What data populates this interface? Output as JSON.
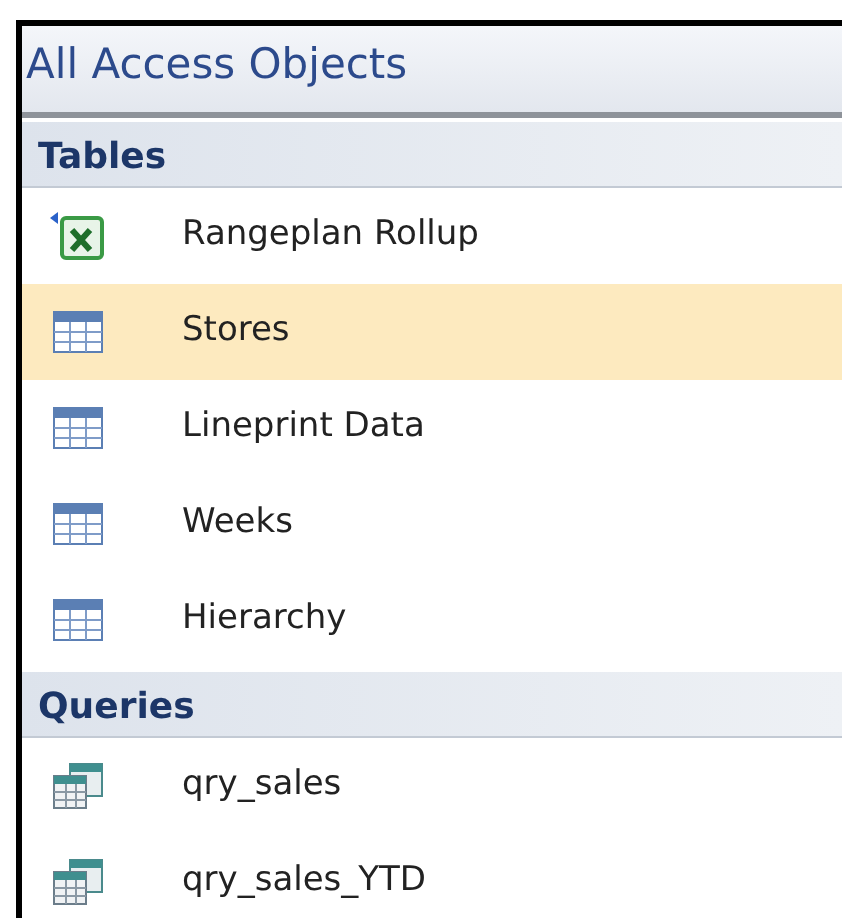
{
  "pane": {
    "title": "All Access Objects"
  },
  "groups": [
    {
      "label": "Tables",
      "items": [
        {
          "label": "Rangeplan Rollup",
          "kind": "linked-excel",
          "selected": false
        },
        {
          "label": "Stores",
          "kind": "table",
          "selected": true
        },
        {
          "label": "Lineprint Data",
          "kind": "table",
          "selected": false
        },
        {
          "label": "Weeks",
          "kind": "table",
          "selected": false
        },
        {
          "label": "Hierarchy",
          "kind": "table",
          "selected": false
        }
      ]
    },
    {
      "label": "Queries",
      "items": [
        {
          "label": "qry_sales",
          "kind": "query",
          "selected": false
        },
        {
          "label": "qry_sales_YTD",
          "kind": "query",
          "selected": false
        }
      ]
    }
  ]
}
